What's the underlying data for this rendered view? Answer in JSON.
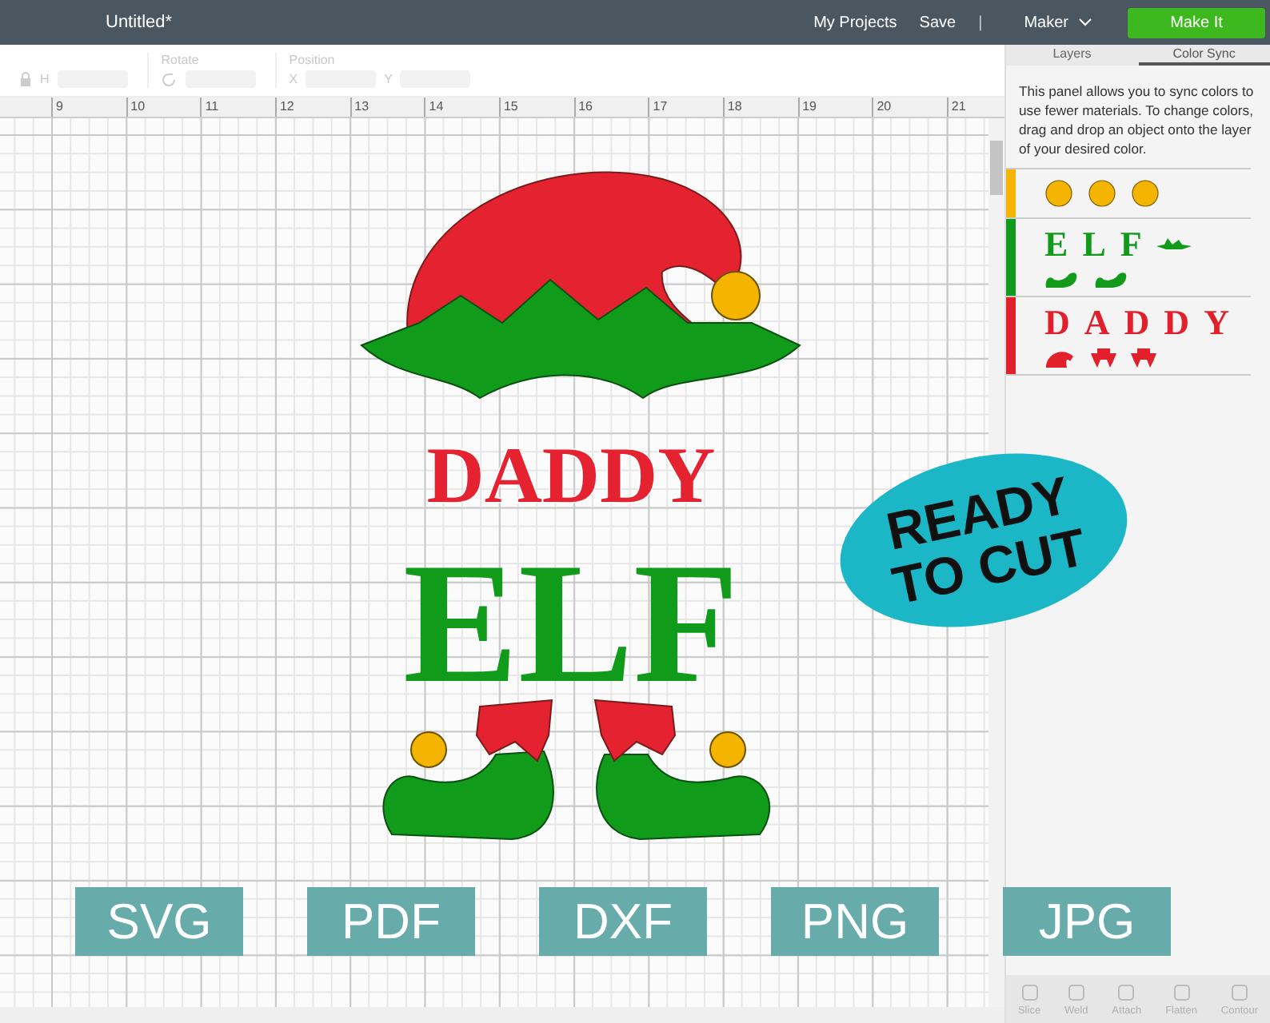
{
  "window": {
    "title": "Untitled*"
  },
  "nav": {
    "links": [
      "My Projects",
      "Save"
    ],
    "separator": "|",
    "machine": "Maker",
    "action": "Make It"
  },
  "toolbar": {
    "size_field": "H",
    "rotate_label": "Rotate",
    "position_label": "Position",
    "position_fields": [
      "X",
      "Y"
    ]
  },
  "ruler": [
    "9",
    "10",
    "11",
    "12",
    "13",
    "14",
    "15",
    "16",
    "17",
    "18",
    "19",
    "20",
    "21"
  ],
  "design": {
    "lines": [
      "DADDY",
      "ELF"
    ]
  },
  "sticker": "READY TO CUT",
  "formats": [
    "SVG",
    "PDF",
    "DXF",
    "PNG",
    "JPG"
  ],
  "panel": {
    "tabs": [
      {
        "label": "Layers",
        "selected": false
      },
      {
        "label": "Color Sync",
        "selected": true
      }
    ],
    "description": "This panel allows you to sync colors to use fewer materials. To change colors, drag and drop an object onto the layer of your desired color.",
    "rows": [
      {
        "color": "#f5b400",
        "items": [
          {
            "kind": "dot"
          },
          {
            "kind": "dot"
          },
          {
            "kind": "dot"
          }
        ]
      },
      {
        "color": "#129b1b",
        "items": [
          {
            "kind": "letter",
            "text": "E"
          },
          {
            "kind": "letter",
            "text": "L"
          },
          {
            "kind": "letter",
            "text": "F"
          },
          {
            "kind": "brim"
          },
          {
            "kind": "shoe"
          },
          {
            "kind": "shoe"
          }
        ]
      },
      {
        "color": "#e2202c",
        "items": [
          {
            "kind": "letter",
            "text": "D"
          },
          {
            "kind": "letter",
            "text": "A"
          },
          {
            "kind": "letter",
            "text": "D"
          },
          {
            "kind": "letter",
            "text": "D"
          },
          {
            "kind": "letter",
            "text": "Y"
          },
          {
            "kind": "hat"
          },
          {
            "kind": "cuff"
          },
          {
            "kind": "cuff"
          }
        ]
      }
    ]
  },
  "actions": [
    {
      "label": "Slice",
      "disabled": true
    },
    {
      "label": "Weld",
      "disabled": true
    },
    {
      "label": "Attach",
      "disabled": true
    },
    {
      "label": "Flatten",
      "disabled": true
    },
    {
      "label": "Contour",
      "disabled": true
    }
  ]
}
